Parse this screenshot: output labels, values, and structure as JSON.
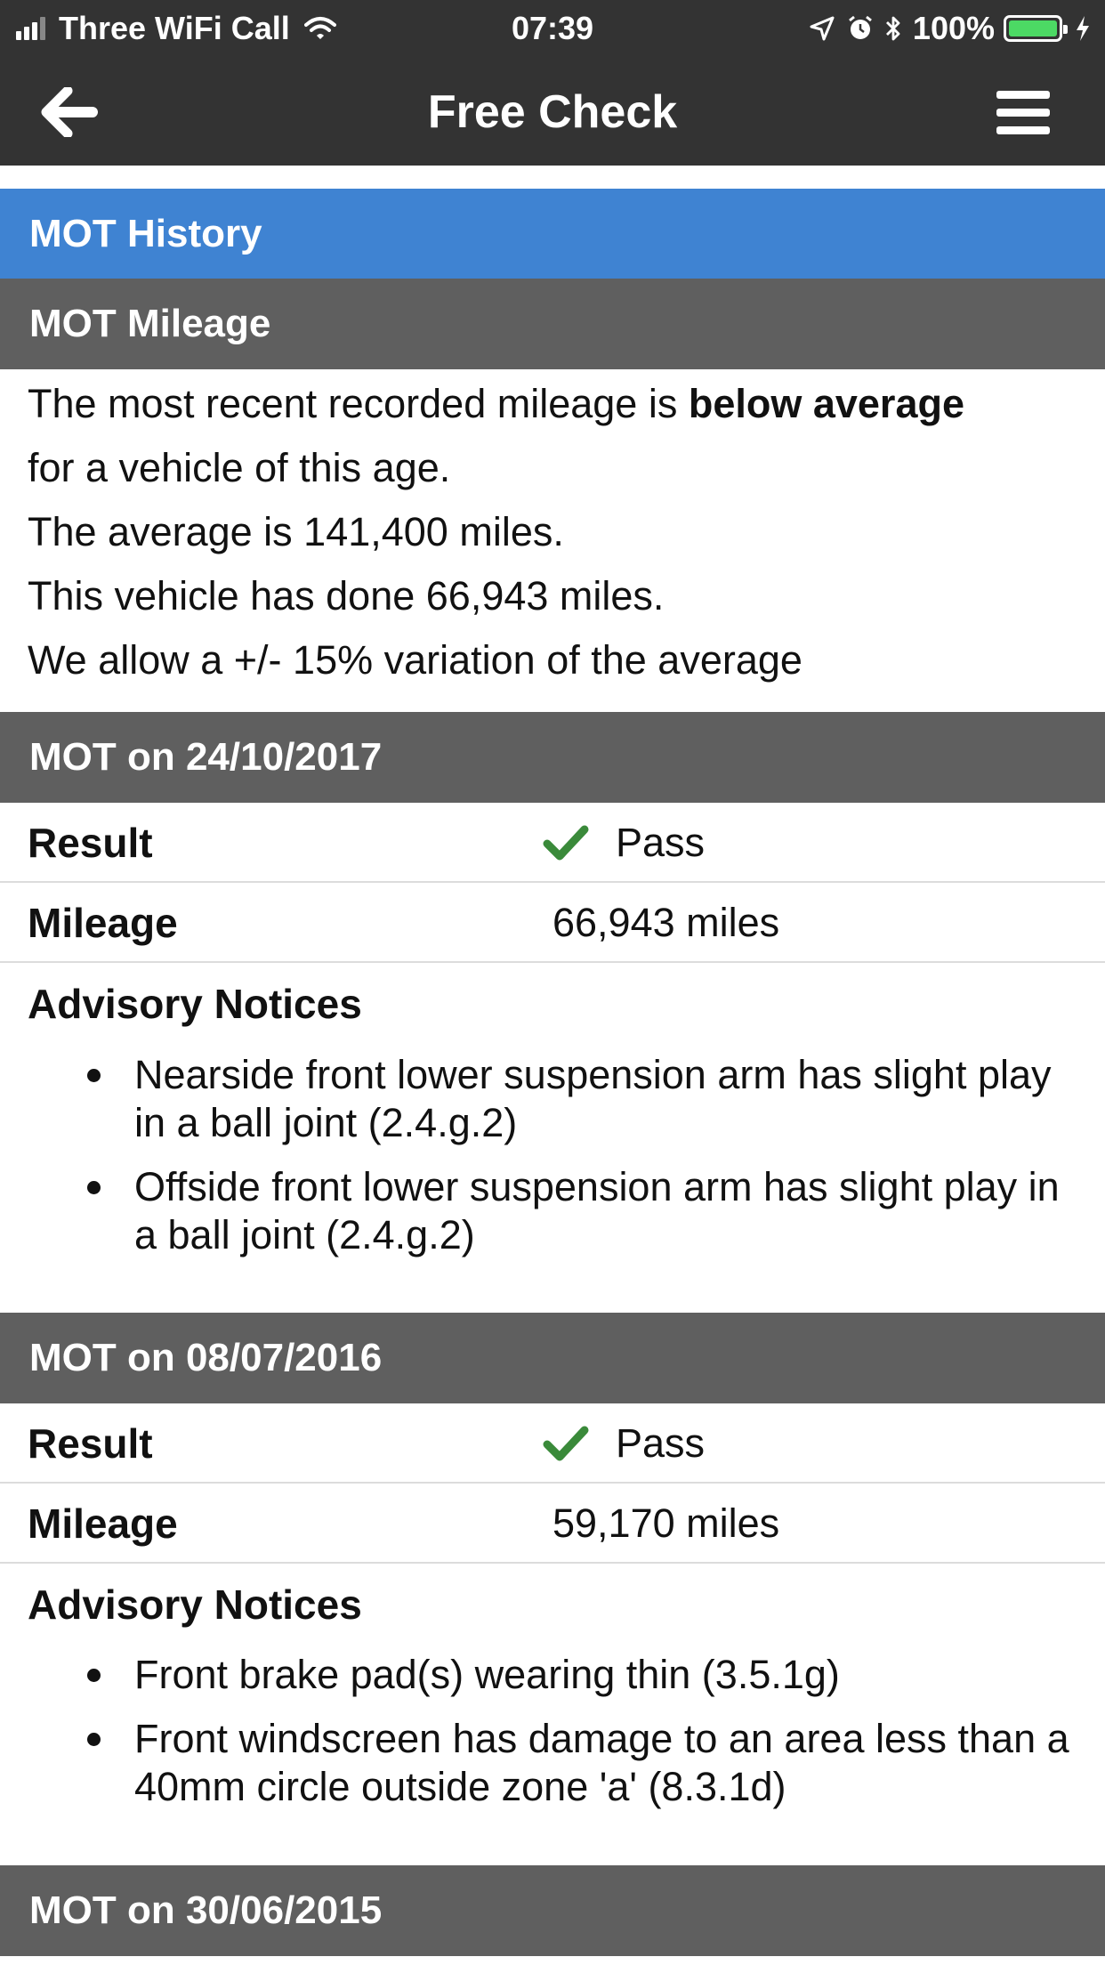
{
  "status_bar": {
    "carrier": "Three WiFi Call",
    "time": "07:39",
    "battery": "100%",
    "battery_color": "#4cd964"
  },
  "nav": {
    "title": "Free Check",
    "back_icon": "arrow-left-icon",
    "menu_icon": "hamburger-menu-icon"
  },
  "colors": {
    "accent": "#3f83d2",
    "header_gray": "#5f5f5f",
    "bar": "#333333",
    "pass_green": "#3a8a3a"
  },
  "sections": {
    "history_title": "MOT History",
    "mileage_title": "MOT Mileage"
  },
  "mileage_summary": {
    "line1_prefix": "The most recent recorded mileage is ",
    "line1_bold": "below average",
    "line2": "for a vehicle of this age.",
    "line3": "The average is 141,400 miles.",
    "line4": "This vehicle has done 66,943 miles.",
    "line5": "We allow a +/- 15% variation of the average"
  },
  "labels": {
    "result": "Result",
    "mileage": "Mileage",
    "advisory": "Advisory Notices"
  },
  "mots": [
    {
      "header": "MOT on 24/10/2017",
      "result": "Pass",
      "mileage": "66,943 miles",
      "advisories": [
        "Nearside front lower suspension arm has slight play in a ball joint (2.4.g.2)",
        "Offside front lower suspension arm has slight play in a ball joint (2.4.g.2)"
      ]
    },
    {
      "header": "MOT on 08/07/2016",
      "result": "Pass",
      "mileage": "59,170 miles",
      "advisories": [
        "Front brake pad(s) wearing thin (3.5.1g)",
        "Front windscreen has damage to an area less than a 40mm circle outside zone 'a' (8.3.1d)"
      ]
    },
    {
      "header": "MOT on 30/06/2015"
    }
  ]
}
